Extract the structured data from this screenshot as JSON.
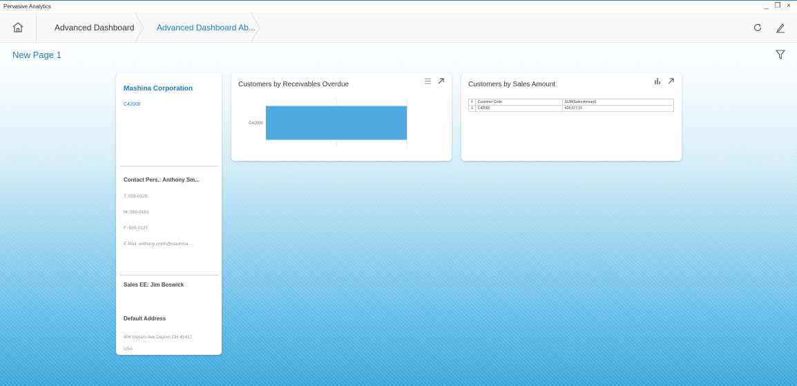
{
  "window": {
    "title": "Pervasive Analytics",
    "minimize": "_",
    "restore": "❐",
    "close": "×"
  },
  "nav": {
    "home_icon": "home-icon",
    "breadcrumbs": [
      {
        "label": "Advanced Dashboard"
      },
      {
        "label": "Advanced Dashboard Ab..."
      }
    ],
    "refresh_icon": "refresh-icon",
    "edit_icon": "edit-icon"
  },
  "page": {
    "title": "New Page 1",
    "filter_icon": "filter-icon"
  },
  "customer_card": {
    "name": "Mashina Corporation",
    "code": "C42000",
    "contact": "Contact Pers.: Anthony Sm...",
    "phone": "T: 555-0126",
    "mobile": "M: 555-0183",
    "fax": "F: 555-0127",
    "email": "E-Mail: anthony.smith@mashina....",
    "sales_ee": "Sales EE: Jim Boswick",
    "address_title": "Default Address",
    "address_line": "406 Ingram Ave  Dayton OH  45417",
    "country": "USA"
  },
  "receivables_card": {
    "title": "Customers by Receivables Overdue",
    "icons": [
      "list-icon",
      "expand-icon"
    ]
  },
  "chart_data": {
    "type": "bar",
    "orientation": "horizontal",
    "title": "Customers by Receivables Overdue",
    "categories": [
      "C42000"
    ],
    "values": [
      1
    ],
    "xlim": [
      0,
      1.2
    ],
    "grid": true,
    "color": "#4ea9df"
  },
  "sales_card": {
    "title": "Customers by Sales Amount",
    "icons": [
      "bar-chart-icon",
      "expand-icon"
    ],
    "columns": [
      "#",
      "Customer Code",
      "SUM(Sales Amount)"
    ],
    "rows": [
      [
        "1",
        "C42000",
        "428,677.33"
      ]
    ]
  },
  "colors": {
    "accent": "#1a7bbf",
    "bar": "#4ea9df",
    "background": "#4aaee0"
  }
}
